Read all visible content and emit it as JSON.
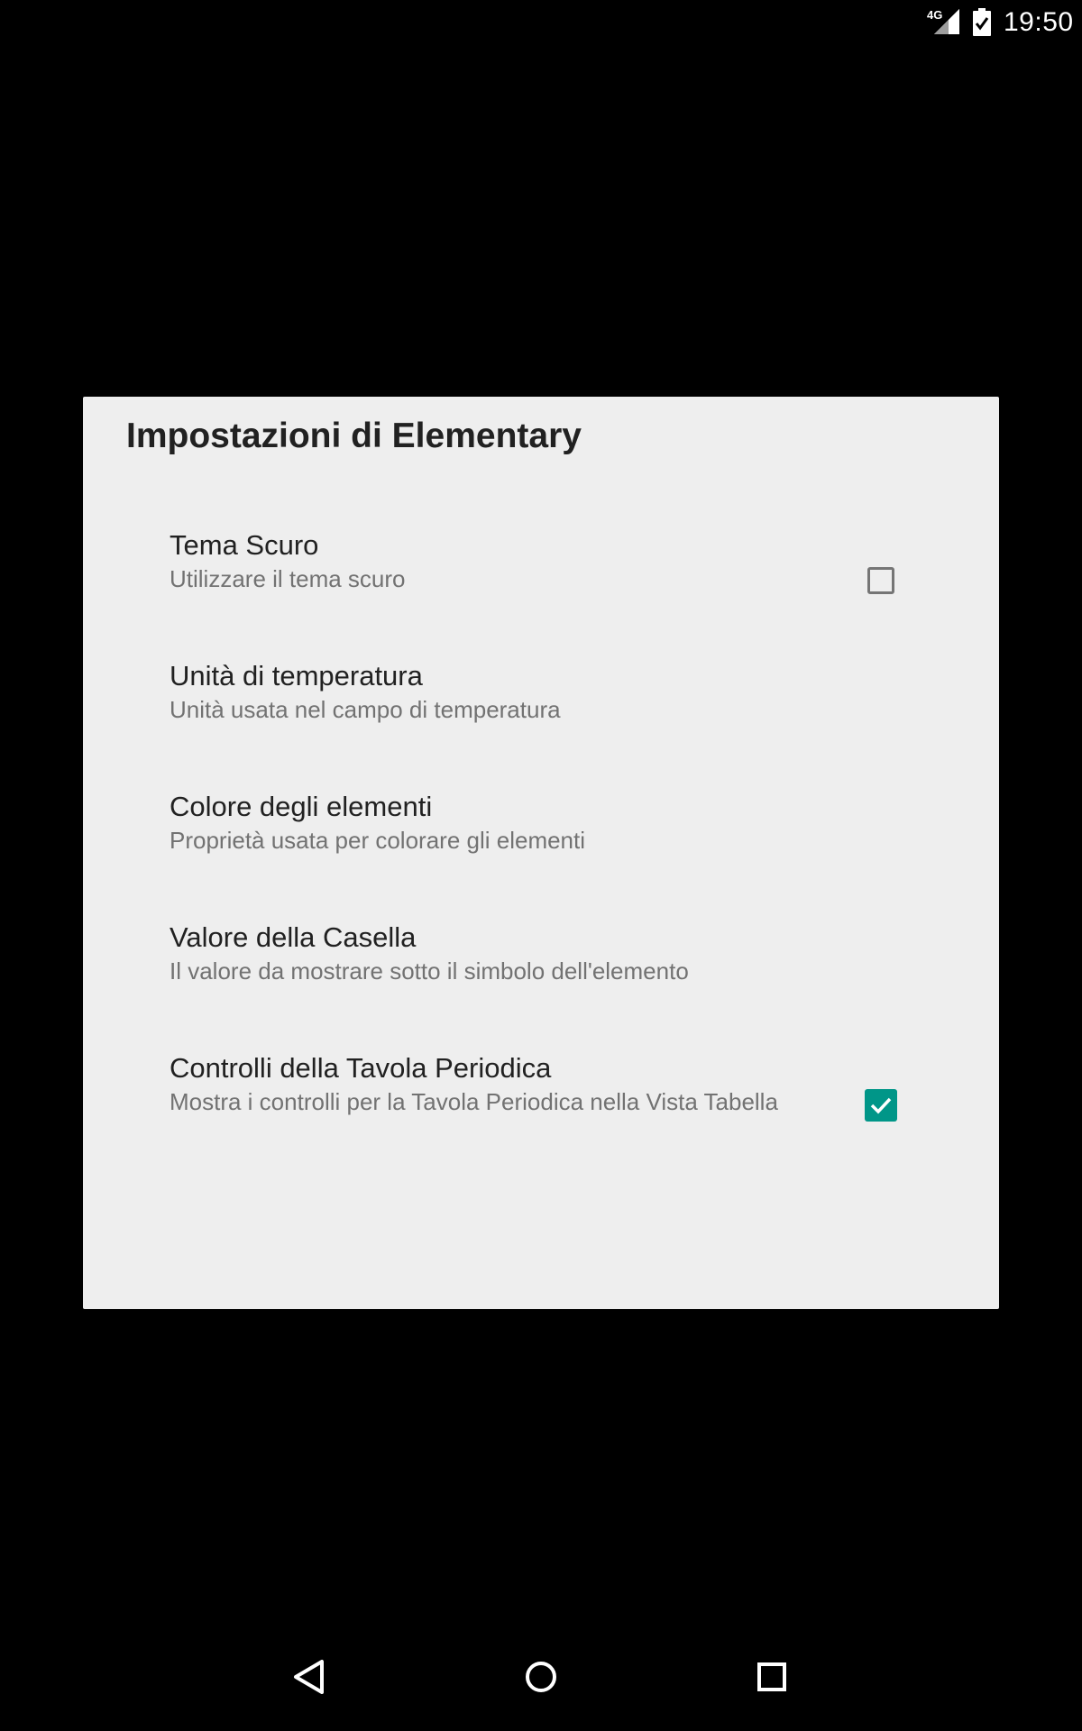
{
  "status_bar": {
    "network_type": "4G",
    "time": "19:50"
  },
  "dialog": {
    "title": "Impostazioni di Elementary",
    "preferences": [
      {
        "title": "Tema Scuro",
        "summary": "Utilizzare il tema scuro",
        "has_checkbox": true,
        "checked": false
      },
      {
        "title": "Unità di temperatura",
        "summary": "Unità usata nel campo di temperatura",
        "has_checkbox": false
      },
      {
        "title": "Colore degli elementi",
        "summary": "Proprietà usata per colorare gli elementi",
        "has_checkbox": false
      },
      {
        "title": "Valore della Casella",
        "summary": "Il valore da mostrare sotto il simbolo dell'elemento",
        "has_checkbox": false
      },
      {
        "title": "Controlli della Tavola Periodica",
        "summary": "Mostra i controlli per la Tavola Periodica nella Vista Tabella",
        "has_checkbox": true,
        "checked": true
      }
    ]
  },
  "navigation": {
    "buttons": [
      "back-icon",
      "home-icon",
      "recents-icon"
    ]
  },
  "colors": {
    "accent": "#009688",
    "dialog_background": "#eeeeee",
    "screen_background": "#000000"
  }
}
